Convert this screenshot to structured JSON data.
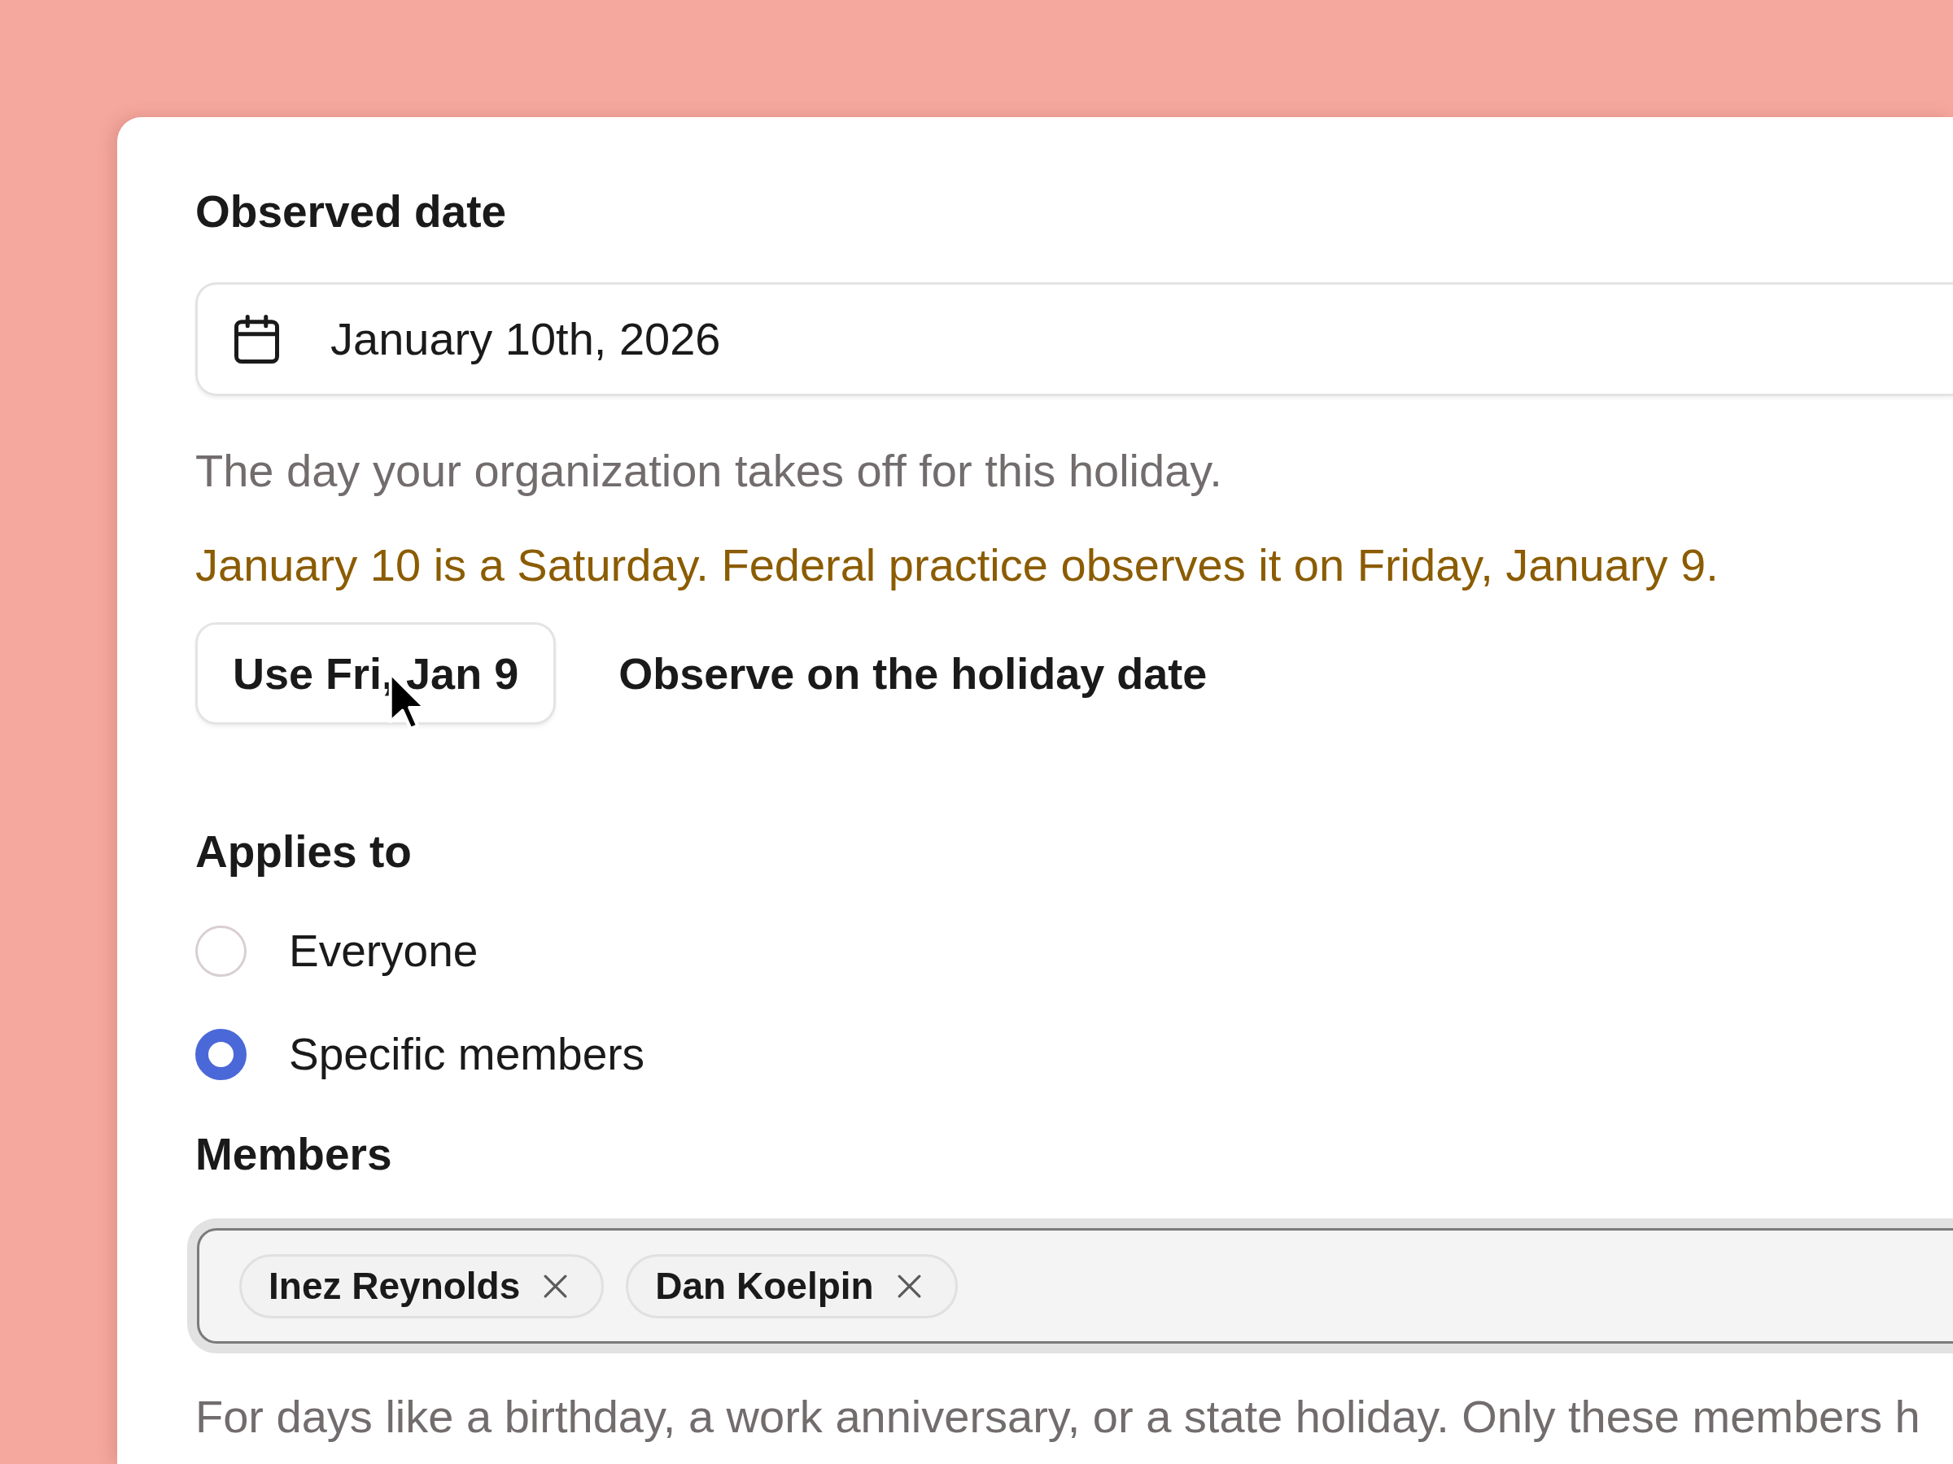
{
  "observed_date": {
    "label": "Observed date",
    "value": "January 10th, 2026",
    "helper": "The day your organization takes off for this holiday.",
    "warning": "January 10 is a Saturday. Federal practice observes it on Friday, January 9.",
    "actions": [
      {
        "kind": "outlined",
        "label": "Use Fri, Jan 9"
      },
      {
        "kind": "text",
        "label": "Observe on the holiday date"
      }
    ]
  },
  "applies_to": {
    "label": "Applies to",
    "options": [
      {
        "label": "Everyone",
        "selected": false
      },
      {
        "label": "Specific members",
        "selected": true
      }
    ]
  },
  "members": {
    "label": "Members",
    "focused": true,
    "chips": [
      "Inez Reynolds",
      "Dan Koelpin"
    ],
    "helper": "For days like a birthday, a work anniversary, or a state holiday. Only these members h"
  }
}
